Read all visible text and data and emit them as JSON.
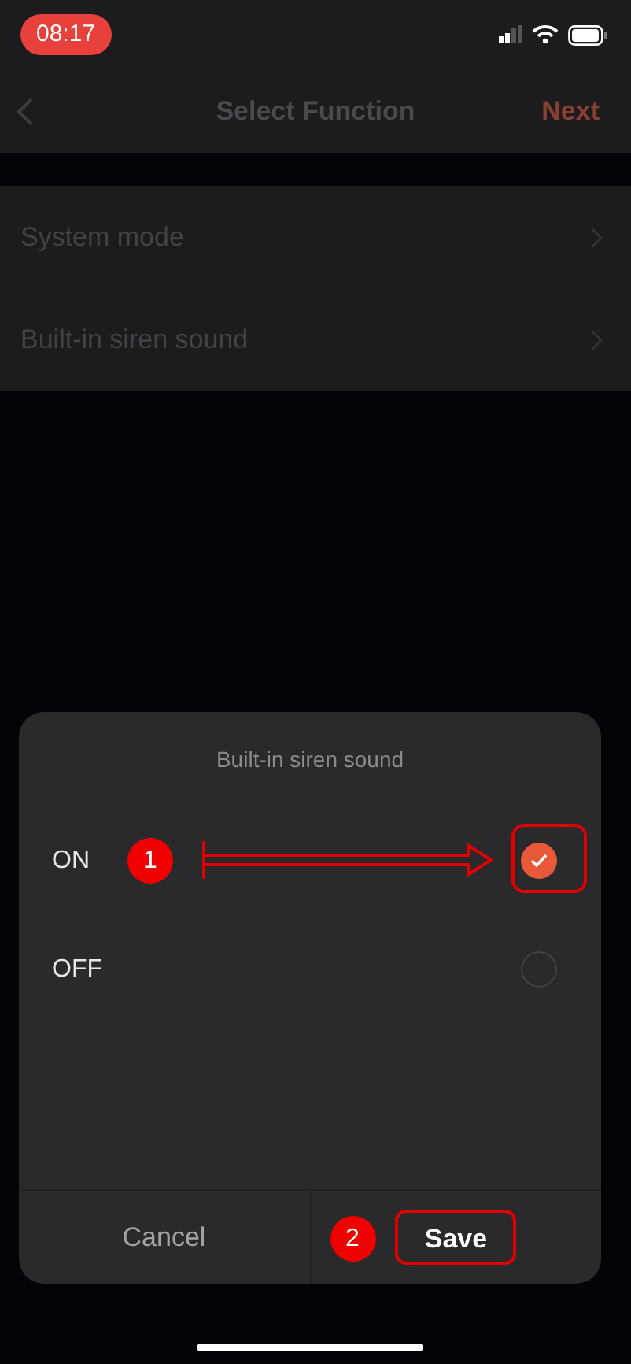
{
  "status_bar": {
    "time": "08:17"
  },
  "nav": {
    "title": "Select Function",
    "action": "Next"
  },
  "settings": [
    {
      "label": "System mode"
    },
    {
      "label": "Built-in siren sound"
    }
  ],
  "dialog": {
    "title": "Built-in siren sound",
    "options": [
      {
        "label": "ON",
        "selected": true,
        "highlighted": true,
        "callout": "1"
      },
      {
        "label": "OFF",
        "selected": false,
        "highlighted": false
      }
    ],
    "buttons": [
      {
        "label": "Cancel",
        "kind": "cancel",
        "highlighted": false
      },
      {
        "label": "Save",
        "kind": "save",
        "highlighted": true,
        "callout": "2"
      }
    ]
  }
}
